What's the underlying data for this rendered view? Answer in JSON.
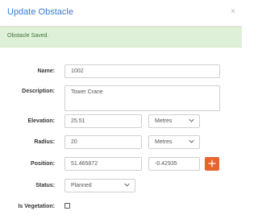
{
  "dialog": {
    "title": "Update Obstacle",
    "close_label": "×"
  },
  "alert": {
    "message": "Obstacle Saved."
  },
  "form": {
    "name_label": "Name:",
    "name_value": "1002",
    "description_label": "Description:",
    "description_value": "Tower Crane",
    "elevation_label": "Elevation:",
    "elevation_value": "25.51",
    "elevation_unit": "Metres",
    "radius_label": "Radius:",
    "radius_value": "20",
    "radius_unit": "Metres",
    "position_label": "Position:",
    "position_lat": "51.465872",
    "position_lon": "-0.42935",
    "status_label": "Status:",
    "status_value": "Planned",
    "vegetation_label": "Is Vegetation:"
  },
  "icons": {
    "locate_button": "crosshair-icon",
    "chevron": "chevron-down-icon"
  },
  "colors": {
    "title": "#3a7bd5",
    "alert_bg": "#dff0d8",
    "alert_text": "#3c763d",
    "locate_button": "#e8642c"
  }
}
